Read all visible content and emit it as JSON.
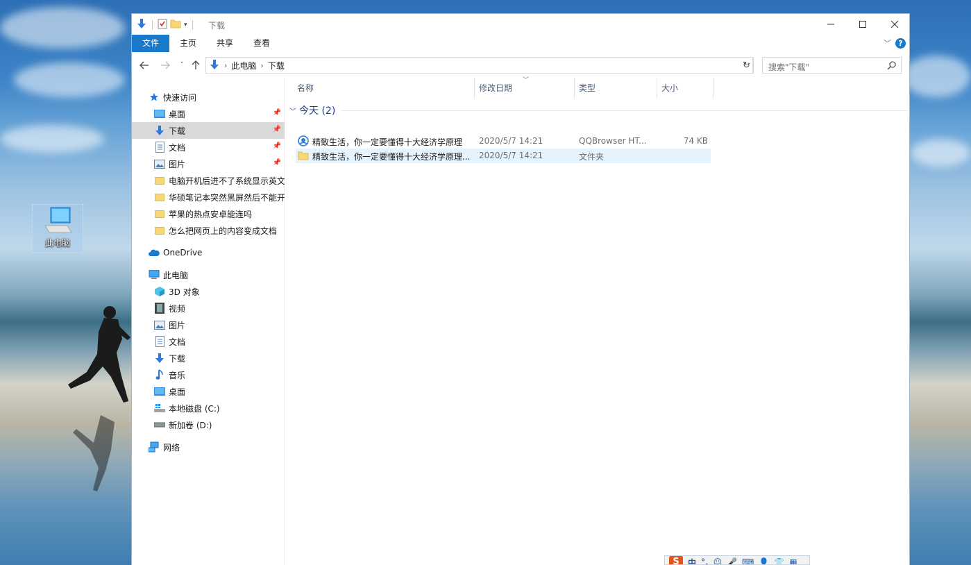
{
  "desktop": {
    "icon_label": "此电脑"
  },
  "window": {
    "title": "下载",
    "accent_color": "#1979ca",
    "ribbon_tabs": [
      "文件",
      "主页",
      "共享",
      "查看"
    ],
    "help_label": "?"
  },
  "address": {
    "crumbs": [
      "此电脑",
      "下载"
    ],
    "search_placeholder": "搜索\"下载\""
  },
  "nav_pane": {
    "quick_access": "快速访问",
    "pinned": [
      "桌面",
      "下载",
      "文档",
      "图片"
    ],
    "recent": [
      "电脑开机后进不了系统显示英文",
      "华硕笔记本突然黑屏然后不能开",
      "苹果的热点安卓能连吗",
      "怎么把网页上的内容变成文档"
    ],
    "onedrive": "OneDrive",
    "this_pc": "此电脑",
    "pc_items": [
      "3D 对象",
      "视频",
      "图片",
      "文档",
      "下载",
      "音乐",
      "桌面",
      "本地磁盘 (C:)",
      "新加卷 (D:)"
    ],
    "network": "网络"
  },
  "content": {
    "columns": [
      "名称",
      "修改日期",
      "类型",
      "大小"
    ],
    "group": "今天 (2)",
    "files": [
      {
        "name": "精致生活，你一定要懂得十大经济学原理",
        "date": "2020/5/7 14:21",
        "type": "QQBrowser HT...",
        "size": "74 KB",
        "icon": "qqbrowser-html-icon"
      },
      {
        "name": "精致生活，你一定要懂得十大经济学原理...",
        "date": "2020/5/7 14:21",
        "type": "文件夹",
        "size": "",
        "icon": "folder-icon"
      }
    ]
  },
  "ime": {
    "logo": "S",
    "lang": "中"
  }
}
